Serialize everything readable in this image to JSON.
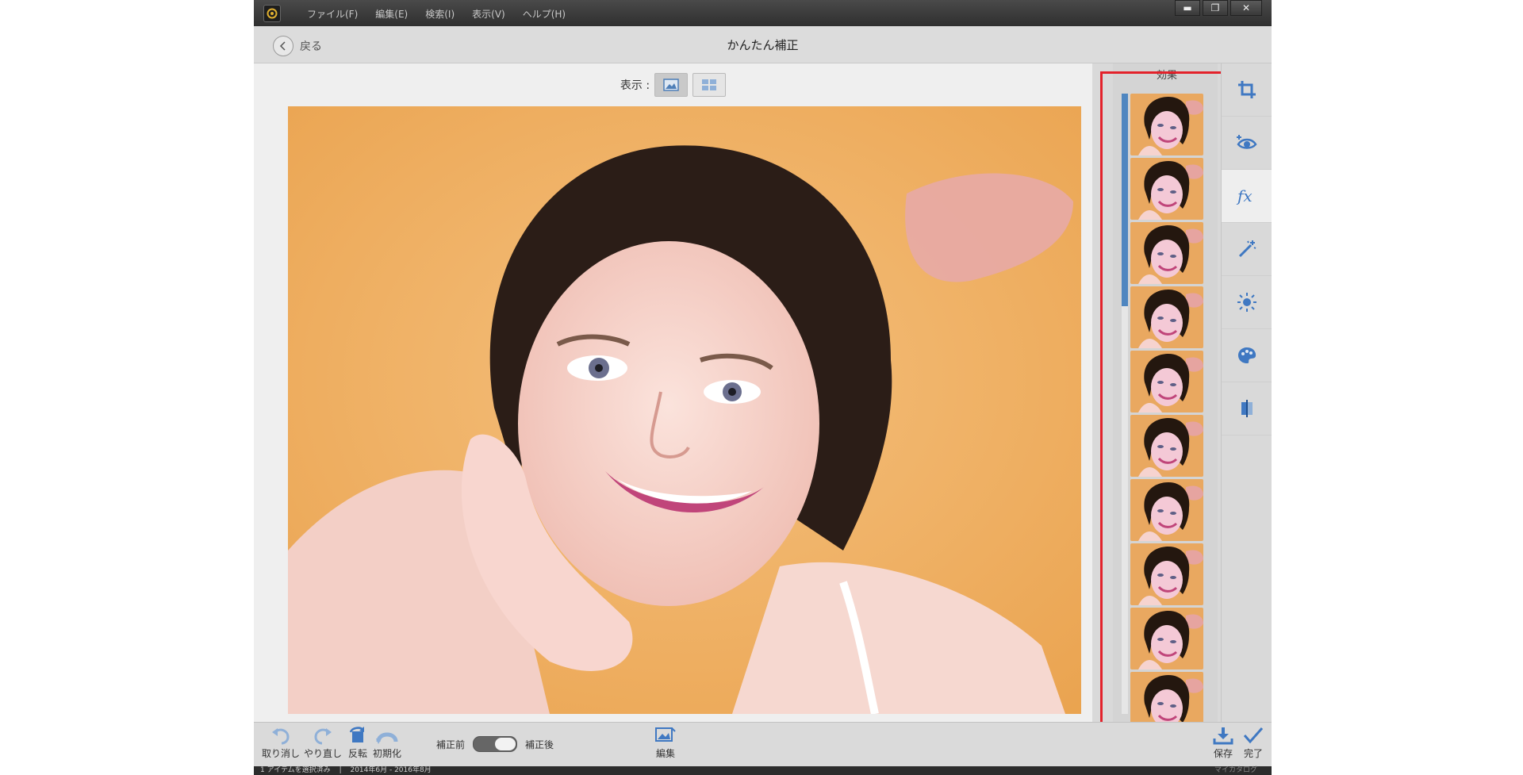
{
  "menu": [
    "ファイル(F)",
    "編集(E)",
    "検索(I)",
    "表示(V)",
    "ヘルプ(H)"
  ],
  "window_controls": {
    "minimize": "▬",
    "restore": "❐",
    "close": "✕"
  },
  "header": {
    "back_label": "戻る",
    "title": "かんたん補正"
  },
  "view": {
    "label": "表示 :"
  },
  "effects": {
    "title": "効果",
    "thumb_count": 10
  },
  "bottom": {
    "undo": "取り消し",
    "redo": "やり直し",
    "rotate": "反転",
    "reset": "初期化",
    "before": "補正前",
    "after": "補正後",
    "edit": "編集",
    "save": "保存",
    "done": "完了"
  },
  "status": {
    "selection": "1 アイテムを選択済み",
    "date_range": "2014年6月 - 2016年8月",
    "catalog": "マイカタログ"
  },
  "colors": {
    "accent": "#4f86c0",
    "highlight": "#e3222b"
  }
}
